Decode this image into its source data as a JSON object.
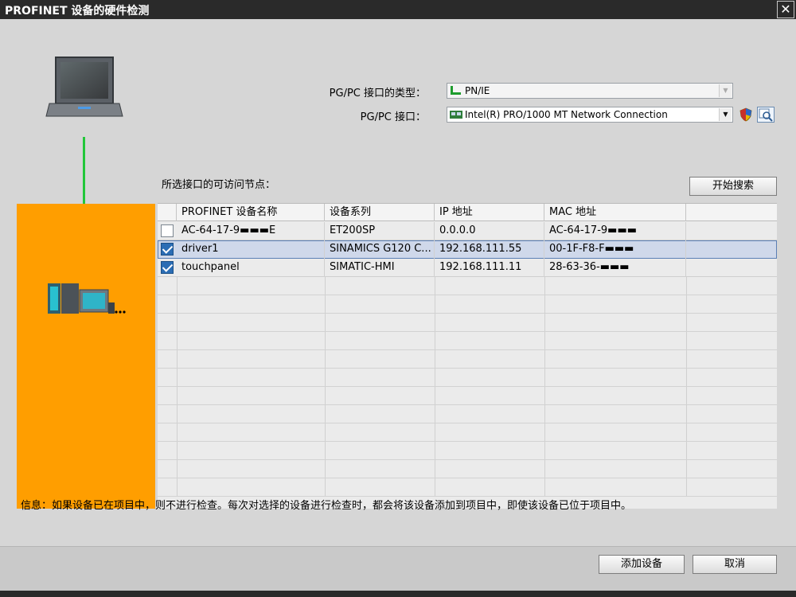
{
  "window": {
    "title": "PROFINET 设备的硬件检测",
    "close_glyph": "✕"
  },
  "interface": {
    "type_label": "PG/PC 接口的类型：",
    "type_value": "PN/IE",
    "iface_label": "PG/PC 接口：",
    "iface_value": "Intel(R) PRO/1000 MT Network Connection"
  },
  "nodes": {
    "label": "所选接口的可访问节点：",
    "search_button": "开始搜索",
    "columns": [
      "PROFINET 设备名称",
      "设备系列",
      "IP 地址",
      "MAC 地址"
    ],
    "rows": [
      {
        "checked": false,
        "selected": false,
        "name": "AC-64-17-9▬▬▬E",
        "family": "ET200SP",
        "ip": "0.0.0.0",
        "mac": "AC-64-17-9▬▬▬"
      },
      {
        "checked": true,
        "selected": true,
        "name": "driver1",
        "family": "SINAMICS G120 C...",
        "ip": "192.168.111.55",
        "mac": "00-1F-F8-F▬▬▬"
      },
      {
        "checked": true,
        "selected": false,
        "name": "touchpanel",
        "family": "SIMATIC-HMI",
        "ip": "192.168.111.11",
        "mac": "28-63-36-▬▬▬"
      }
    ]
  },
  "info": "信息：如果设备已在项目中，则不进行检查。每次对选择的设备进行检查时，都会将该设备添加到项目中，即使该设备已位于项目中。",
  "footer": {
    "add_button": "添加设备",
    "cancel_button": "取消"
  },
  "colors": {
    "link": "#22c73a",
    "device_panel": "#ff9e00",
    "checkbox": "#2b6db4"
  },
  "icons": {
    "pc": "laptop-icon",
    "device": "plc-hmi-device-icon",
    "network": "network-plug-icon",
    "nic": "network-card-icon",
    "shield": "shield-icon",
    "diagnostics": "diagnostics-icon"
  }
}
